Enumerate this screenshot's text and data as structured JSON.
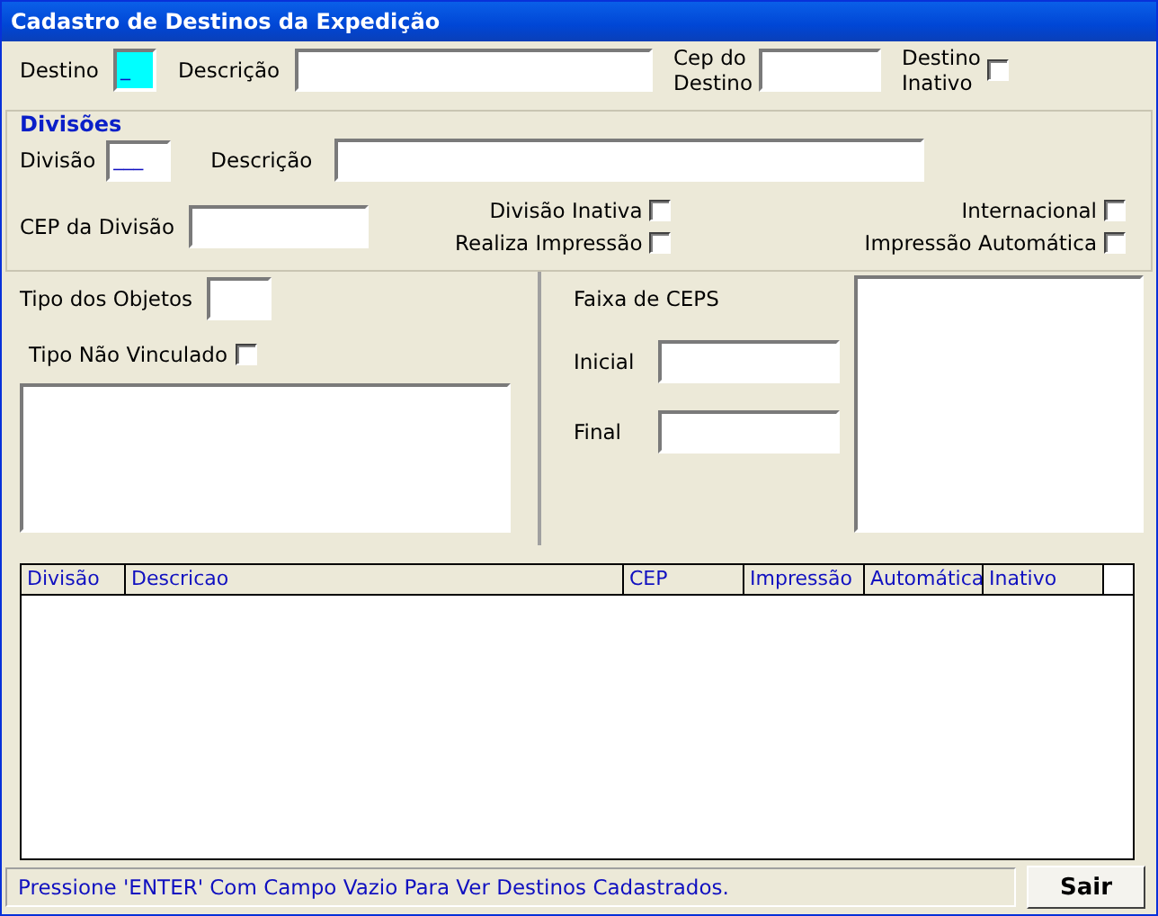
{
  "window": {
    "title": "Cadastro de Destinos da Expedição"
  },
  "destino": {
    "label": "Destino",
    "value": "_",
    "focused": true,
    "descricao_label": "Descrição",
    "cep_label_1": "Cep do",
    "cep_label_2": "Destino",
    "inativo_label_1": "Destino",
    "inativo_label_2": "Inativo",
    "inativo_checked": false
  },
  "divisoes": {
    "title": "Divisões",
    "divisao_label": "Divisão",
    "divisao_value": "___",
    "descricao_label": "Descrição",
    "cep_label": "CEP da Divisão",
    "checks": [
      {
        "label": "Divisão Inativa",
        "checked": false
      },
      {
        "label": "Realiza Impressão",
        "checked": false
      },
      {
        "label": "Internacional",
        "checked": false
      },
      {
        "label": "Impressão Automática",
        "checked": false
      }
    ]
  },
  "tipo": {
    "label": "Tipo dos Objetos",
    "nao_vinculado_label": "Tipo Não Vinculado",
    "nao_vinculado_checked": false
  },
  "faixa": {
    "title": "Faixa de CEPS",
    "inicial_label": "Inicial",
    "final_label": "Final"
  },
  "table": {
    "columns": [
      "Divisão",
      "Descricao",
      "CEP",
      "Impressão",
      "Automática",
      "Inativo"
    ]
  },
  "status_bar": {
    "message": "Pressione 'ENTER' Com Campo Vazio Para Ver Destinos Cadastrados."
  },
  "exit_button": {
    "label": "Sair"
  }
}
